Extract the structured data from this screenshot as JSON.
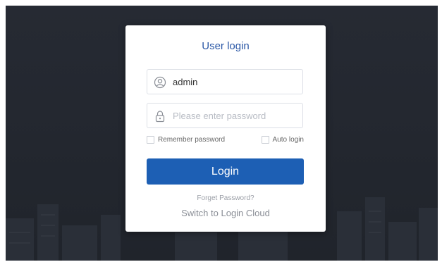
{
  "login_form": {
    "title": "User login",
    "username_value": "admin",
    "password_placeholder": "Please enter password",
    "remember_label": "Remember password",
    "auto_login_label": "Auto login",
    "login_label": "Login",
    "forget_label": "Forget Password?",
    "switch_label": "Switch to Login Cloud"
  },
  "icons": {
    "username": "user-icon",
    "password": "lock-icon"
  },
  "colors": {
    "background": "#23272f",
    "accent": "#1d5fb4",
    "title": "#2a57a6"
  }
}
